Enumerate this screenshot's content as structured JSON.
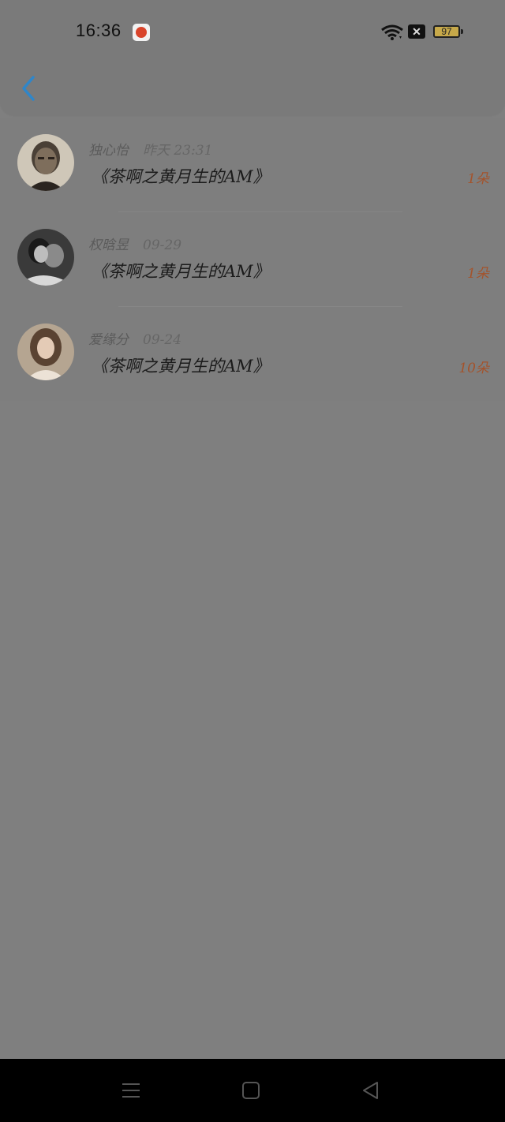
{
  "status_bar": {
    "time": "16:36",
    "x_label": "✕",
    "battery": "97"
  },
  "header": {
    "back_icon": "chevron-left-icon"
  },
  "colors": {
    "accent": "#2f86c9",
    "count": "#a4532b"
  },
  "list": [
    {
      "name": "独心怡",
      "date": "昨天 23:31",
      "title": "《茶啊之黄月生的AM》",
      "count": "1朵"
    },
    {
      "name": "权晗昱",
      "date": "09-29",
      "title": "《茶啊之黄月生的AM》",
      "count": "1朵"
    },
    {
      "name": "爱缘分",
      "date": "09-24",
      "title": "《茶啊之黄月生的AM》",
      "count": "10朵"
    }
  ]
}
